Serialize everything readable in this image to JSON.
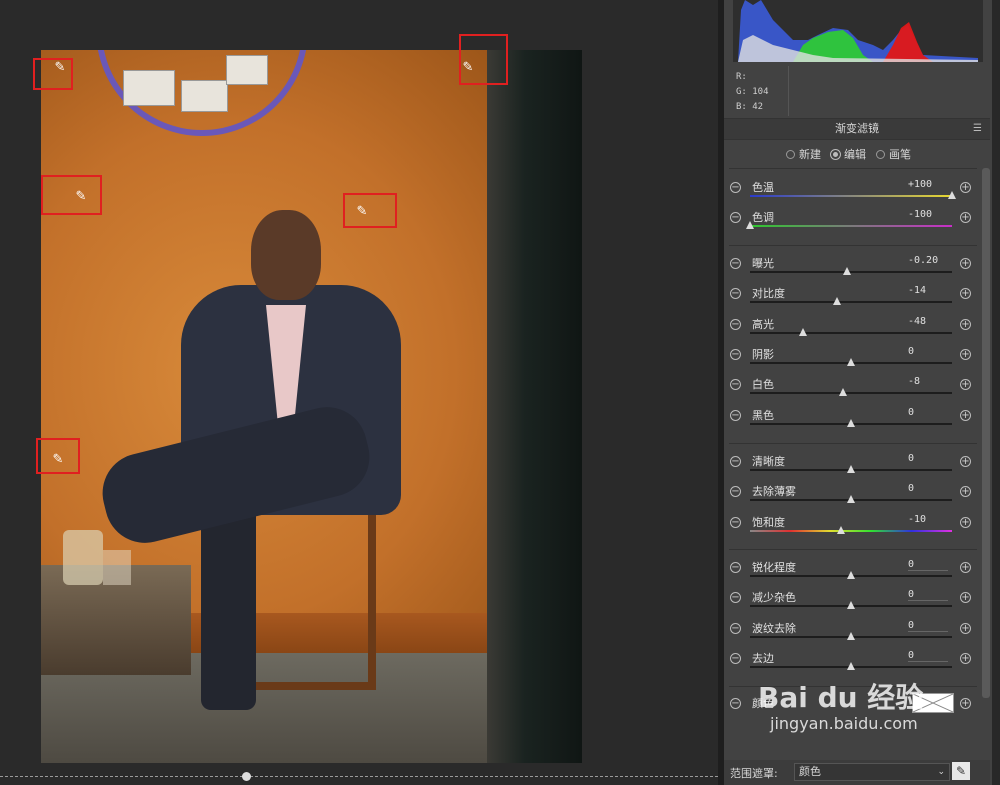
{
  "canvas": {
    "markers": [
      "mask-pin-1",
      "mask-pin-2",
      "mask-pin-3",
      "mask-pin-4",
      "mask-pin-5"
    ]
  },
  "info": {
    "r_label": "R:",
    "r_value": "",
    "g_label": "G:",
    "g_value": "104",
    "b_label": "B:",
    "b_value": "42"
  },
  "panel": {
    "title": "渐变滤镜",
    "modes": [
      {
        "label": "新建",
        "selected": false
      },
      {
        "label": "编辑",
        "selected": true
      },
      {
        "label": "画笔",
        "selected": false
      }
    ],
    "groups": [
      [
        {
          "label": "色温",
          "value": "+100",
          "pos": 1.0,
          "track": "temp"
        },
        {
          "label": "色调",
          "value": "-100",
          "pos": 0.0,
          "track": "tint"
        }
      ],
      [
        {
          "label": "曝光",
          "value": "-0.20",
          "pos": 0.48,
          "track": "plain"
        },
        {
          "label": "对比度",
          "value": "-14",
          "pos": 0.43,
          "track": "plain"
        },
        {
          "label": "高光",
          "value": "-48",
          "pos": 0.26,
          "track": "plain"
        },
        {
          "label": "阴影",
          "value": "0",
          "pos": 0.5,
          "track": "plain"
        },
        {
          "label": "白色",
          "value": "-8",
          "pos": 0.46,
          "track": "plain"
        },
        {
          "label": "黑色",
          "value": "0",
          "pos": 0.5,
          "track": "plain"
        }
      ],
      [
        {
          "label": "清晰度",
          "value": "0",
          "pos": 0.5,
          "track": "plain"
        },
        {
          "label": "去除薄雾",
          "value": "0",
          "pos": 0.5,
          "track": "plain"
        },
        {
          "label": "饱和度",
          "value": "-10",
          "pos": 0.45,
          "track": "sat"
        }
      ],
      [
        {
          "label": "锐化程度",
          "value": "0",
          "pos": 0.5,
          "track": "plain"
        },
        {
          "label": "减少杂色",
          "value": "0",
          "pos": 0.5,
          "track": "plain"
        },
        {
          "label": "波纹去除",
          "value": "0",
          "pos": 0.5,
          "track": "plain"
        },
        {
          "label": "去边",
          "value": "0",
          "pos": 0.5,
          "track": "plain"
        }
      ]
    ],
    "color_label": "颜色",
    "range_mask_label": "范围遮罩:",
    "range_mask_value": "颜色"
  },
  "watermark": {
    "brand": "Bai du 经验",
    "url": "jingyan.baidu.com"
  },
  "colors": {
    "marker": "#e02020",
    "panel": "#424242",
    "wall": "#c47326"
  }
}
